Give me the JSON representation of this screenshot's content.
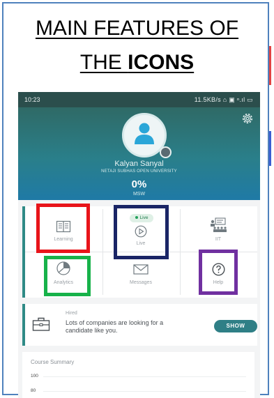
{
  "slide": {
    "title_line1": "MAIN FEATURES OF",
    "title_line2_prefix": "THE ",
    "title_line2_bold": "ICONS"
  },
  "status_bar": {
    "time": "10:23",
    "indicators": "11.5KB/s ⌂ ▣ ⁿ.ıl ▭"
  },
  "profile": {
    "name": "Kalyan Sanyal",
    "university": "NETAJI SUBHAS OPEN UNIVERSITY",
    "progress": "0%",
    "degree": "MSW",
    "icons": [
      "settings-gear-icon",
      "user-avatar-icon",
      "camera-icon"
    ]
  },
  "features": {
    "items": [
      {
        "label": "Learning",
        "icon": "book-icon"
      },
      {
        "label": "Live",
        "icon": "play-circle-icon",
        "badge": "Live"
      },
      {
        "label": "IIT",
        "icon": "classroom-icon"
      },
      {
        "label": "Analytics",
        "icon": "pie-chart-icon"
      },
      {
        "label": "Messages",
        "icon": "envelope-icon"
      },
      {
        "label": "Help",
        "icon": "question-icon"
      }
    ]
  },
  "hired": {
    "title": "Hired",
    "message": "Lots of companies are looking for a candidate like you.",
    "button": "SHOW",
    "icon": "briefcase-icon"
  },
  "course_summary": {
    "title": "Course Summary",
    "ticks": [
      "100",
      "80"
    ]
  },
  "colors": {
    "frame_border": "#4f81bd",
    "highlight_red": "#e8141a",
    "highlight_navy": "#1a2566",
    "highlight_green": "#17b24a",
    "highlight_purple": "#7030a0",
    "app_teal": "#2e8a86"
  }
}
